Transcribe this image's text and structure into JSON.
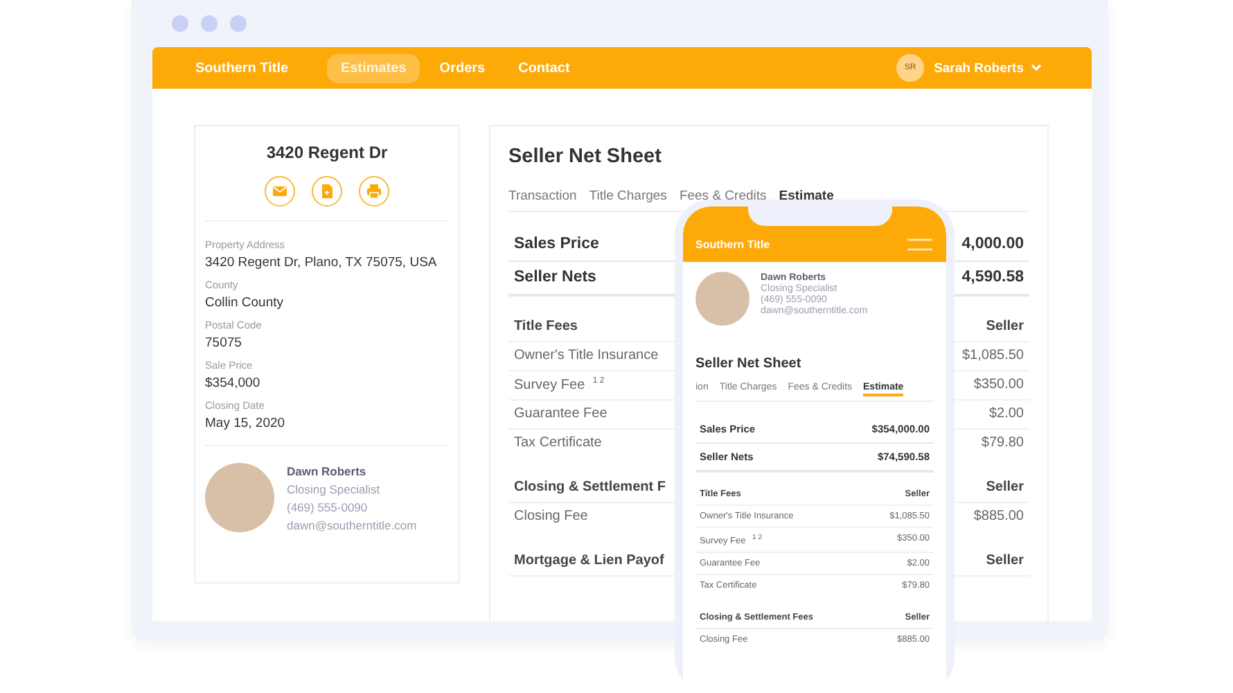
{
  "navbar": {
    "brand": "Southern Title",
    "items": [
      {
        "label": "Estimates",
        "selected": true
      },
      {
        "label": "Orders",
        "selected": false
      },
      {
        "label": "Contact",
        "selected": false
      }
    ],
    "user": {
      "initials": "SR",
      "name": "Sarah Roberts"
    }
  },
  "property_card": {
    "title": "3420 Regent Dr",
    "fields": [
      {
        "label": "Property Address",
        "value": "3420 Regent Dr, Plano, TX 75075, USA"
      },
      {
        "label": "County",
        "value": "Collin County"
      },
      {
        "label": "Postal Code",
        "value": "75075"
      },
      {
        "label": "Sale Price",
        "value": "$354,000"
      },
      {
        "label": "Closing Date",
        "value": "May 15, 2020"
      }
    ],
    "agent": {
      "name": "Dawn Roberts",
      "role": "Closing Specialist",
      "phone": "(469) 555-0090",
      "email": "dawn@southerntitle.com"
    }
  },
  "net_sheet": {
    "title": "Seller Net Sheet",
    "tabs": [
      {
        "label": "Transaction",
        "selected": false
      },
      {
        "label": "Title Charges",
        "selected": false
      },
      {
        "label": "Fees & Credits",
        "selected": false
      },
      {
        "label": "Estimate",
        "selected": true
      }
    ],
    "summary": [
      {
        "label": "Sales Price",
        "value": "4,000.00"
      },
      {
        "label": "Seller Nets",
        "value": "4,590.58"
      }
    ],
    "sections": [
      {
        "heading": "Title Fees",
        "column": "Seller",
        "rows": [
          {
            "label": "Owner's Title Insurance",
            "value": "$1,085.50"
          },
          {
            "label": "Survey Fee $^{1 2}$",
            "value": "$350.00"
          },
          {
            "label": "Guarantee Fee",
            "value": "$2.00"
          },
          {
            "label": "Tax Certificate",
            "value": "$79.80"
          }
        ]
      },
      {
        "heading": "Closing & Settlement F",
        "column": "Seller",
        "rows": [
          {
            "label": "Closing Fee",
            "value": "$885.00"
          }
        ]
      },
      {
        "heading": "Mortgage & Lien Payof",
        "column": "Seller"
      }
    ]
  },
  "phone": {
    "brand": "Southern Title",
    "agent": {
      "name": "Dawn Roberts",
      "role": "Closing Specialist",
      "phone": "(469) 555-0090",
      "email": "dawn@southerntitle.com"
    },
    "title": "Seller Net Sheet",
    "tabs": [
      {
        "label": "ion",
        "selected": false
      },
      {
        "label": "Title Charges",
        "selected": false
      },
      {
        "label": "Fees & Credits",
        "selected": false
      },
      {
        "label": "Estimate",
        "selected": true
      }
    ],
    "summary": [
      {
        "label": "Sales Price",
        "value": "$354,000.00"
      },
      {
        "label": "Seller Nets",
        "value": "$74,590.58"
      }
    ],
    "sections": [
      {
        "heading": "Title Fees",
        "column": "Seller",
        "rows": [
          {
            "label": "Owner's Title Insurance",
            "value": "$1,085.50"
          },
          {
            "label": "Survey Fee $^{1 2}$",
            "value": "$350.00"
          },
          {
            "label": "Guarantee Fee",
            "value": "$2.00"
          },
          {
            "label": "Tax Certificate",
            "value": "$79.80"
          }
        ]
      },
      {
        "heading": "Closing & Settlement Fees",
        "column": "Seller",
        "rows": [
          {
            "label": "Closing Fee",
            "value": "$885.00"
          }
        ]
      }
    ]
  }
}
